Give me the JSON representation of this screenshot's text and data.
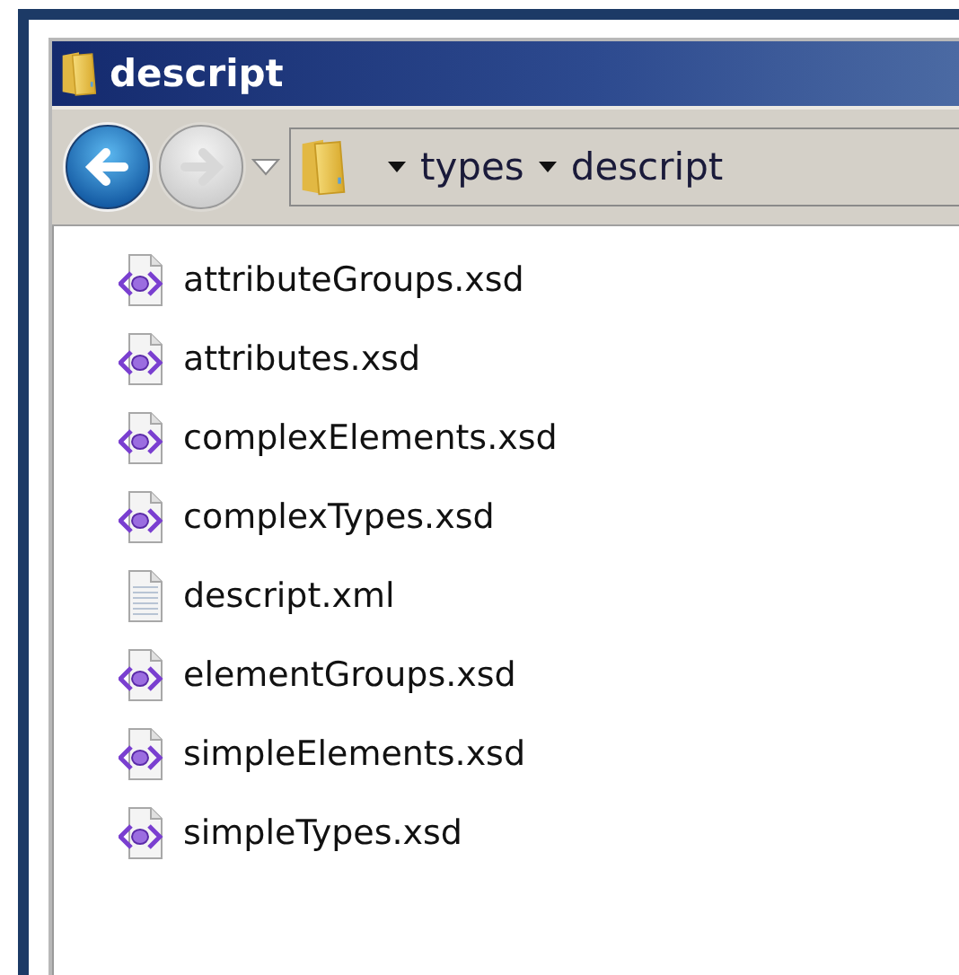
{
  "window": {
    "title": "descript"
  },
  "navigation": {
    "back_enabled": true,
    "forward_enabled": false
  },
  "address_bar": {
    "breadcrumbs": [
      "types",
      "descript"
    ]
  },
  "files": [
    {
      "name": "attributeGroups.xsd",
      "kind": "xsd"
    },
    {
      "name": "attributes.xsd",
      "kind": "xsd"
    },
    {
      "name": "complexElements.xsd",
      "kind": "xsd"
    },
    {
      "name": "complexTypes.xsd",
      "kind": "xsd"
    },
    {
      "name": "descript.xml",
      "kind": "xml"
    },
    {
      "name": "elementGroups.xsd",
      "kind": "xsd"
    },
    {
      "name": "simpleElements.xsd",
      "kind": "xsd"
    },
    {
      "name": "simpleTypes.xsd",
      "kind": "xsd"
    }
  ]
}
